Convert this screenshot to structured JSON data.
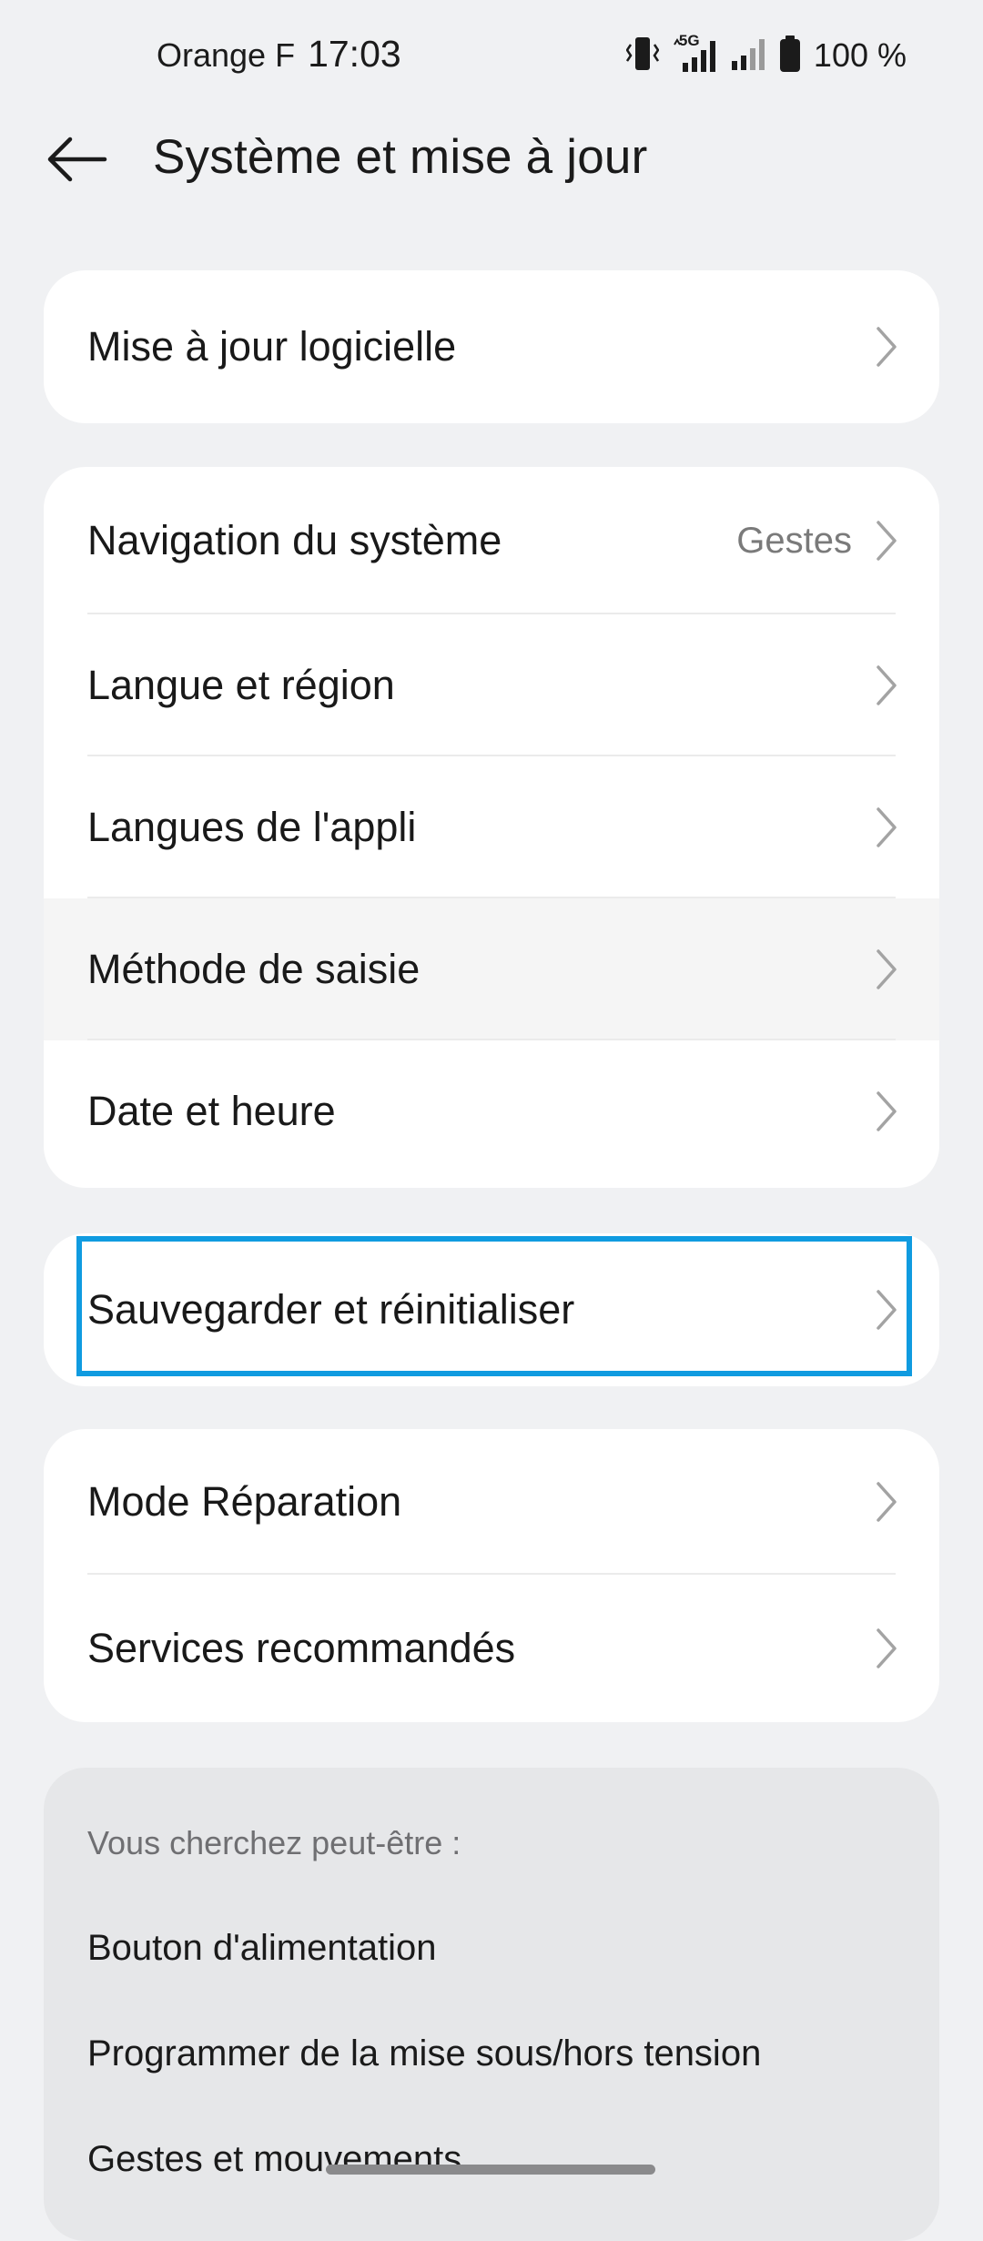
{
  "status_bar": {
    "carrier": "Orange F",
    "time": "17:03",
    "network": "5G",
    "battery": "100 %"
  },
  "header": {
    "title": "Système et mise à jour",
    "back_icon": "arrow-left-icon"
  },
  "groups": {
    "software": {
      "update_label": "Mise à jour logicielle"
    },
    "system": {
      "navigation_label": "Navigation du système",
      "navigation_value": "Gestes",
      "language_region_label": "Langue et région",
      "app_languages_label": "Langues de l'appli",
      "input_method_label": "Méthode de saisie",
      "date_time_label": "Date et heure"
    },
    "backup": {
      "backup_reset_label": "Sauvegarder et réinitialiser"
    },
    "misc": {
      "repair_mode_label": "Mode Réparation",
      "recommended_services_label": "Services recommandés"
    }
  },
  "suggestions": {
    "heading": "Vous cherchez peut-être :",
    "items": [
      "Bouton d'alimentation",
      "Programmer de la mise sous/hors tension",
      "Gestes et mouvements"
    ]
  },
  "colors": {
    "background": "#f0f1f3",
    "card": "#ffffff",
    "highlight": "#109be0",
    "suggest_card": "#e6e7e9"
  }
}
